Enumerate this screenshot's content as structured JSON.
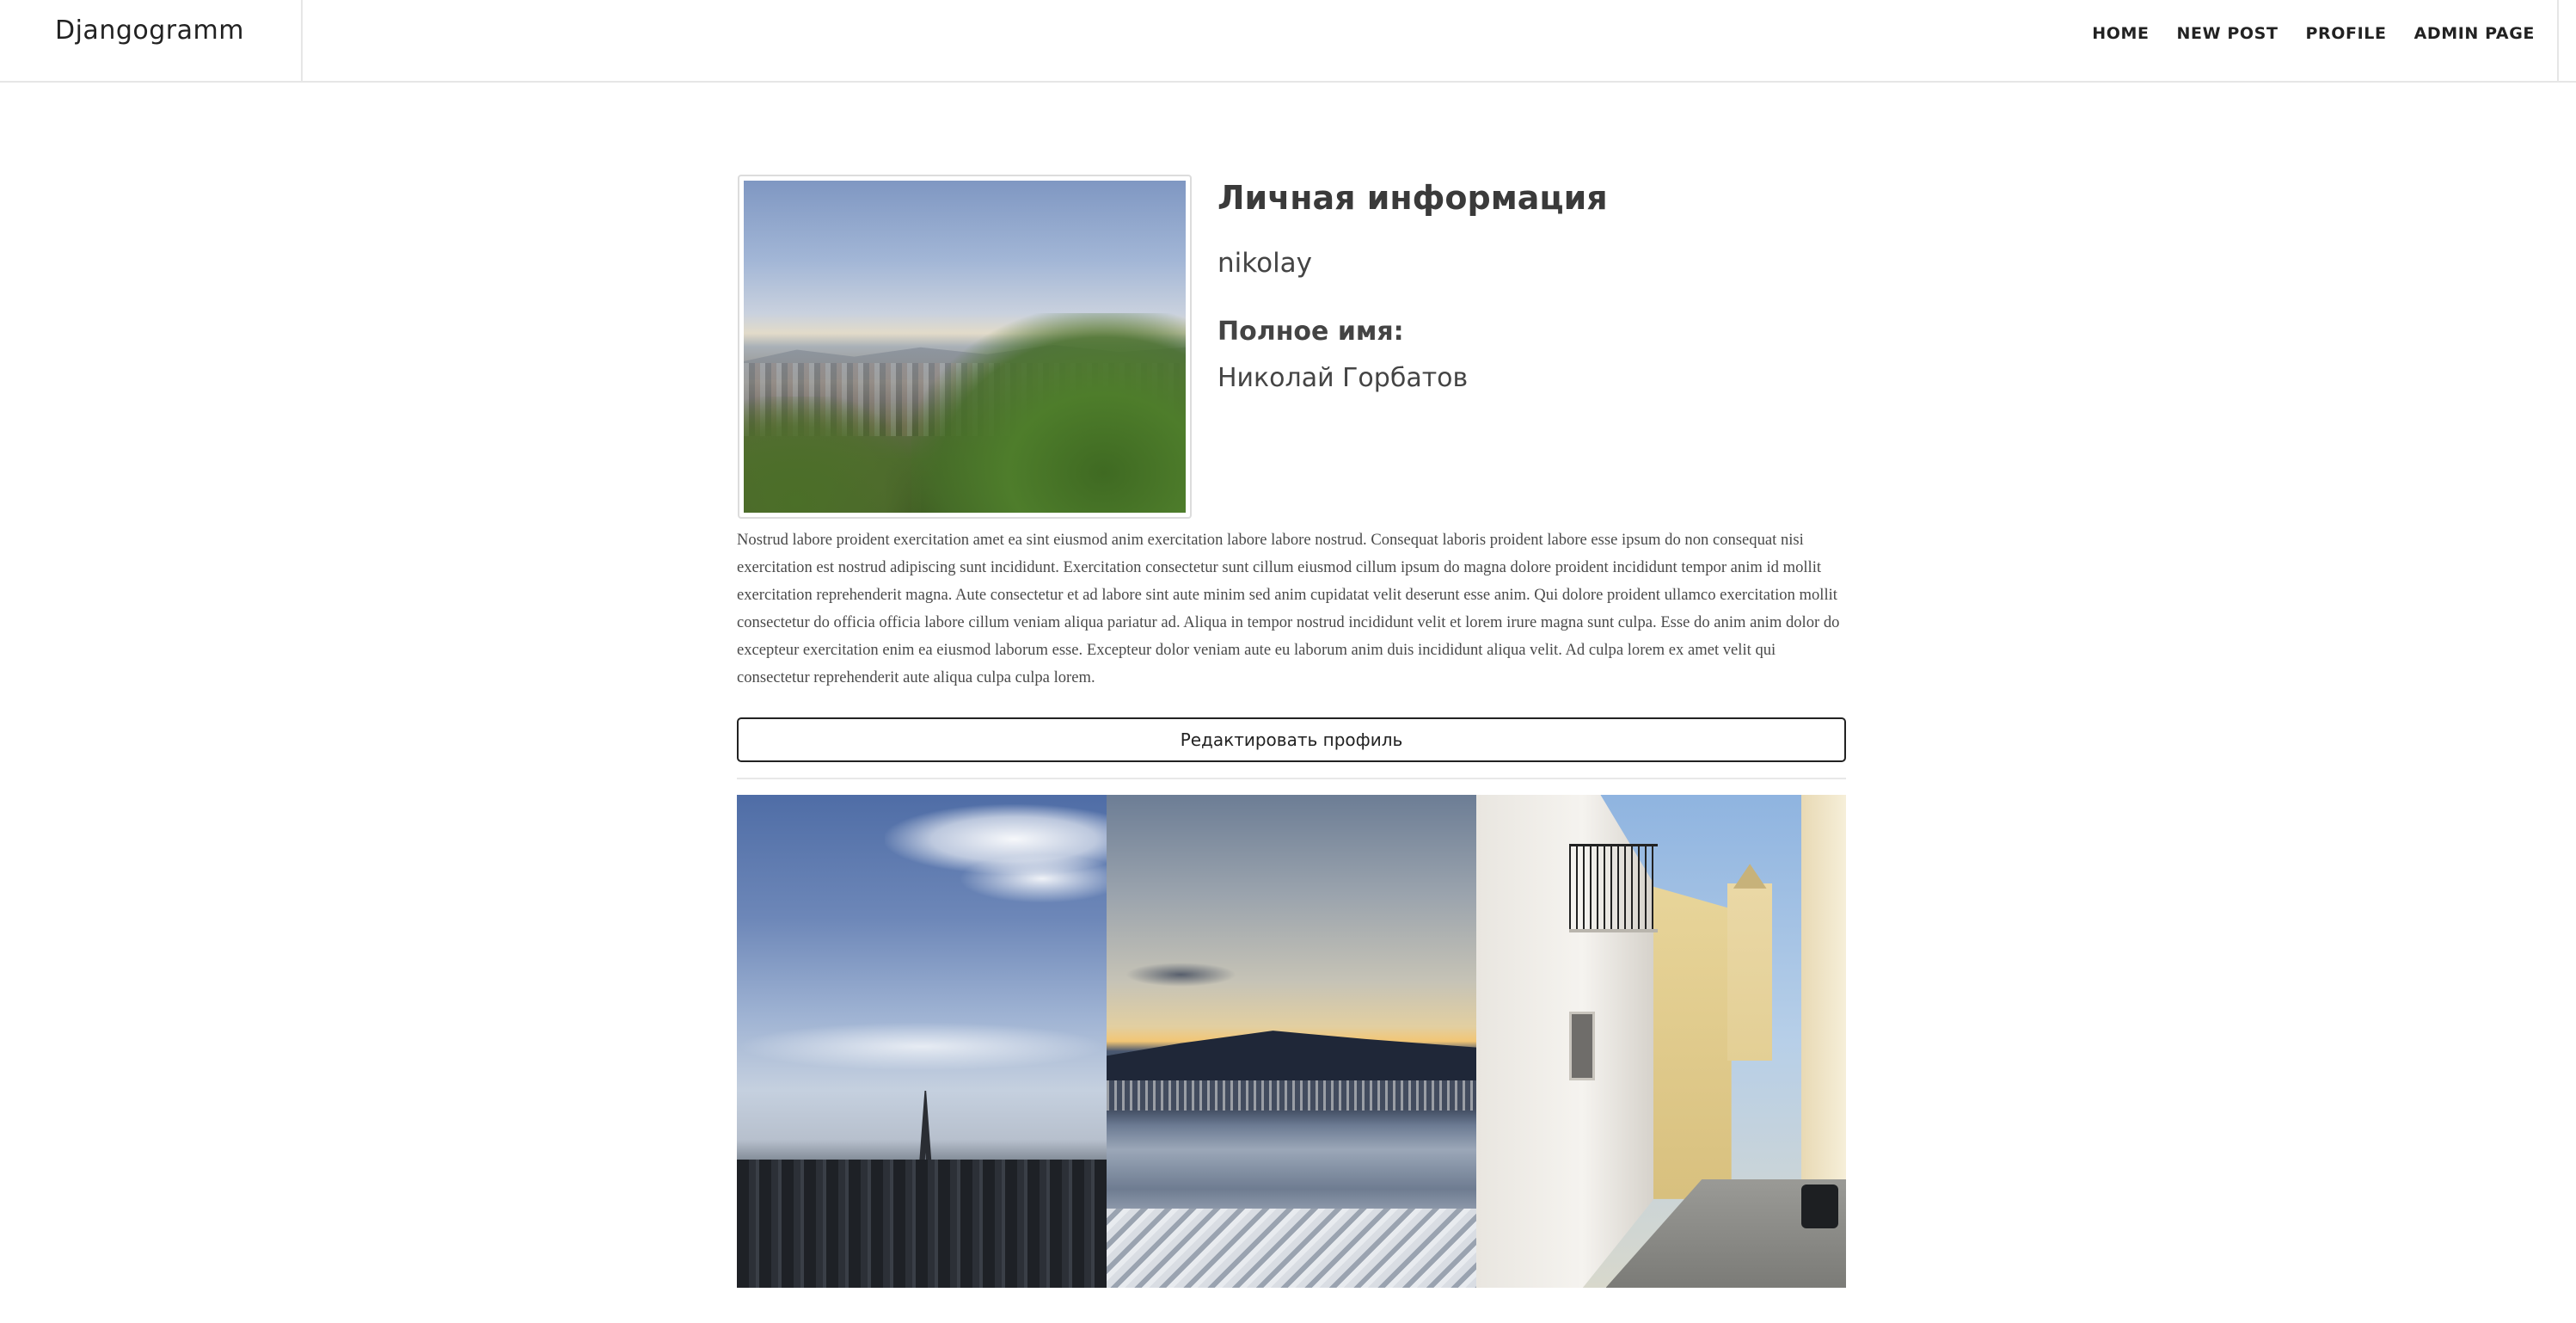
{
  "navbar": {
    "brand": "Djangogramm",
    "links": [
      {
        "label": "HOME"
      },
      {
        "label": "NEW POST"
      },
      {
        "label": "PROFILE"
      },
      {
        "label": "ADMIN PAGE"
      }
    ]
  },
  "profile": {
    "section_title": "Личная информация",
    "username": "nikolay",
    "full_name_label": "Полное имя:",
    "full_name": "Николай Горбатов",
    "bio": "Nostrud labore proident exercitation amet ea sint eiusmod anim exercitation labore labore nostrud. Consequat laboris proident labore esse ipsum do non consequat nisi exercitation est nostrud adipiscing sunt incididunt. Exercitation consectetur sunt cillum eiusmod cillum ipsum do magna dolore proident incididunt tempor anim id mollit exercitation reprehenderit magna. Aute consectetur et ad labore sint aute minim sed anim cupidatat velit deserunt esse anim. Qui dolore proident ullamco exercitation mollit consectetur do officia officia labore cillum veniam aliqua pariatur ad. Aliqua in tempor nostrud incididunt velit et lorem irure magna sunt culpa. Esse do anim anim dolor do excepteur exercitation enim ea eiusmod laborum esse. Excepteur dolor veniam aute eu laborum anim duis incididunt aliqua velit. Ad culpa lorem ex amet velit qui consectetur reprehenderit aute aliqua culpa culpa lorem.",
    "edit_button_label": "Редактировать профиль"
  },
  "posts": [
    {
      "icon": "photo-paris-eiffel-tower"
    },
    {
      "icon": "photo-sunset-sea"
    },
    {
      "icon": "photo-street-bell-tower"
    }
  ]
}
